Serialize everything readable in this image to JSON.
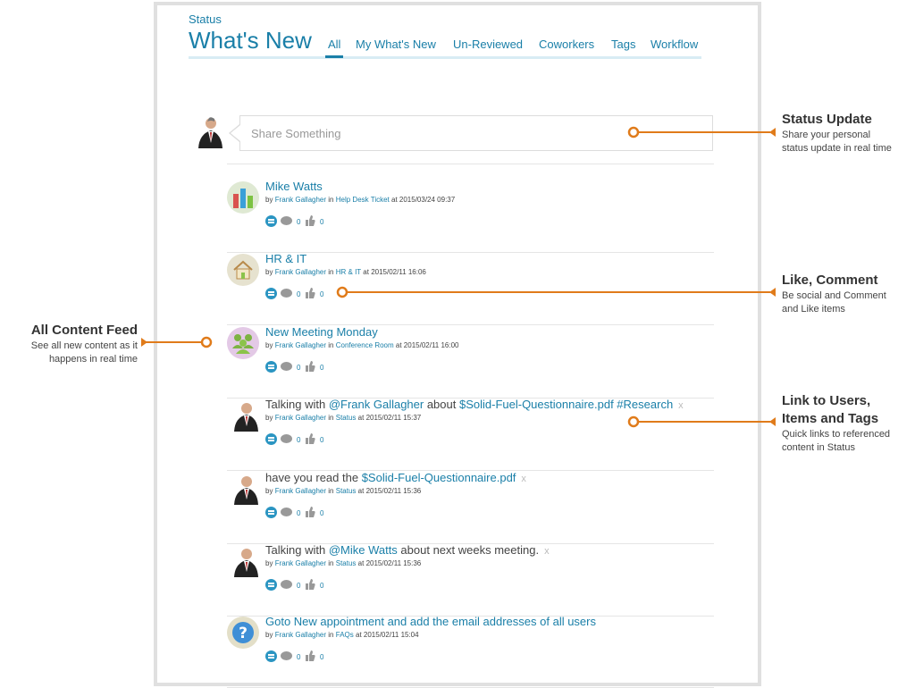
{
  "header": {
    "section_label": "Status",
    "page_title": "What's New",
    "tabs": [
      {
        "label": "All",
        "active": true
      },
      {
        "label": "My What's New",
        "active": false
      },
      {
        "label": "Un-Reviewed",
        "active": false
      },
      {
        "label": "Coworkers",
        "active": false
      },
      {
        "label": "Tags",
        "active": false
      },
      {
        "label": "Workflow",
        "active": false
      }
    ]
  },
  "share": {
    "placeholder": "Share Something"
  },
  "feed": [
    {
      "icon": "chart-icon",
      "title": "Mike Watts",
      "by": "by",
      "author": "Frank Gallagher",
      "in": "in",
      "location": "Help Desk Ticket",
      "at": "at 2015/03/24 09:37",
      "comments": "0",
      "likes": "0"
    },
    {
      "icon": "house-icon",
      "title": "HR & IT",
      "by": "by",
      "author": "Frank Gallagher",
      "in": "in",
      "location": "HR & IT",
      "at": "at 2015/02/11 16:06",
      "comments": "0",
      "likes": "0"
    },
    {
      "icon": "group-icon",
      "title": "New Meeting Monday",
      "by": "by",
      "author": "Frank Gallagher",
      "in": "in",
      "location": "Conference Room",
      "at": "at 2015/02/11 16:00",
      "comments": "0",
      "likes": "0"
    },
    {
      "icon": "person-avatar",
      "title_parts": [
        "Talking with ",
        "@Frank Gallagher",
        " about ",
        "$Solid-Fuel-Questionnaire.pdf #Research"
      ],
      "remove": "x",
      "by": "by",
      "author": "Frank Gallagher",
      "in": "in",
      "location": "Status",
      "at": "at 2015/02/11 15:37",
      "comments": "0",
      "likes": "0"
    },
    {
      "icon": "person-avatar",
      "title_parts": [
        "have you read the ",
        "$Solid-Fuel-Questionnaire.pdf"
      ],
      "remove": "x",
      "by": "by",
      "author": "Frank Gallagher",
      "in": "in",
      "location": "Status",
      "at": "at 2015/02/11 15:36",
      "comments": "0",
      "likes": "0"
    },
    {
      "icon": "person-avatar",
      "title_parts": [
        "Talking with ",
        "@Mike Watts",
        " about next weeks meeting."
      ],
      "remove": "x",
      "by": "by",
      "author": "Frank Gallagher",
      "in": "in",
      "location": "Status",
      "at": "at 2015/02/11 15:36",
      "comments": "0",
      "likes": "0"
    },
    {
      "icon": "question-icon",
      "title": "Goto New appointment and add the email addresses of all users",
      "by": "by",
      "author": "Frank Gallagher",
      "in": "in",
      "location": "FAQs",
      "at": "at 2015/02/11 15:04",
      "comments": "0",
      "likes": "0"
    }
  ],
  "callouts": {
    "status_update": {
      "title": "Status Update",
      "desc_line1": "Share your personal",
      "desc_line2": "status update in real time"
    },
    "like_comment": {
      "title": "Like, Comment",
      "desc_line1": "Be social and Comment",
      "desc_line2": "and Like items"
    },
    "all_content": {
      "title": "All Content Feed",
      "desc_line1": "See all new content as it",
      "desc_line2": "happens in real time"
    },
    "link_users": {
      "title_line1": "Link to Users,",
      "title_line2": "Items and Tags",
      "desc_line1": "Quick links to referenced",
      "desc_line2": "content in Status"
    }
  },
  "colors": {
    "accent": "#1a7fa8",
    "callout_line": "#e07b1a"
  }
}
